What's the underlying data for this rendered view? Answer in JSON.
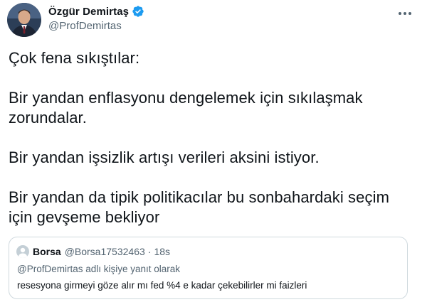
{
  "author": {
    "display_name": "Özgür Demirtaş",
    "handle": "@ProfDemirtas",
    "verified": true,
    "avatar_icon": "profile-photo-icon",
    "verified_icon": "verified-badge-icon"
  },
  "more_icon": "more-options-icon",
  "tweet": {
    "paragraphs": [
      "Çok fena sıkıştılar:",
      "Bir yandan enflasyonu dengelemek için sıkılaşmak zorundalar.",
      "Bir yandan işsizlik artışı verileri aksini istiyor.",
      "Bir yandan da tipik politikacılar bu sonbahardaki seçim için gevşeme bekliyor"
    ]
  },
  "quoted_tweet": {
    "name": "Borsa",
    "handle": "@Borsa17532463",
    "separator": "·",
    "time": "18s",
    "reply_context": "@ProfDemirtas adlı kişiye yanıt olarak",
    "text": "resesyona girmeyi göze alır mı fed %4 e kadar çekebilirler mi faizleri",
    "avatar_icon": "default-avatar-icon"
  },
  "colors": {
    "text_primary": "#0f1419",
    "text_secondary": "#536471",
    "verified_blue": "#1d9bf0",
    "border": "#cfd9de"
  }
}
